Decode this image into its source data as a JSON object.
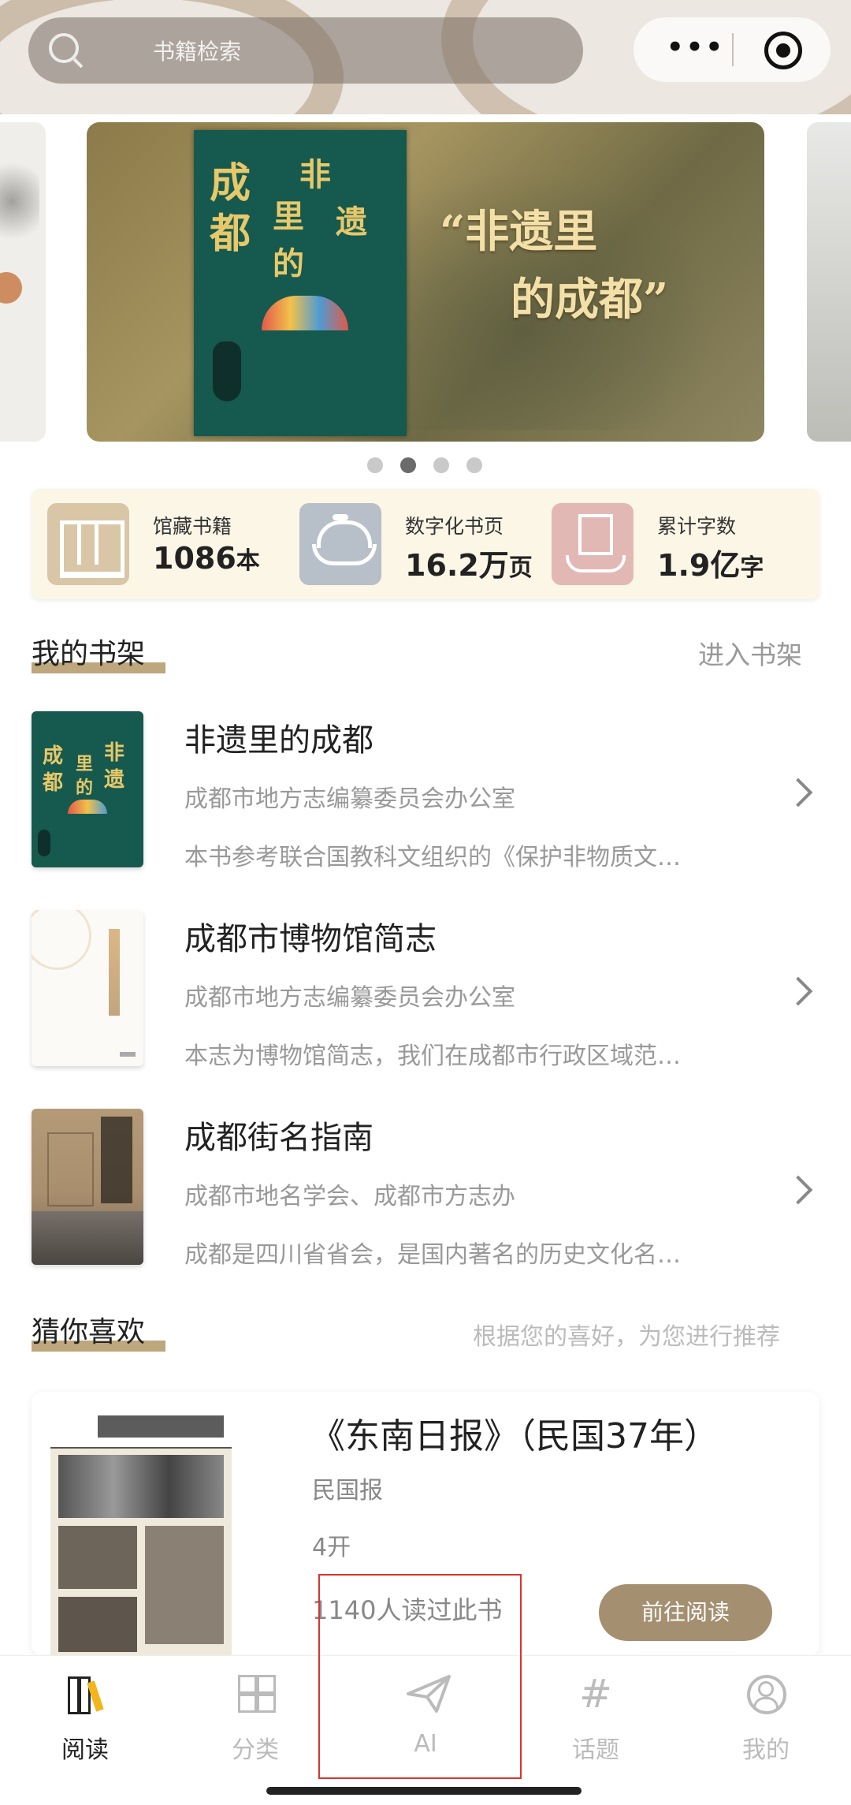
{
  "header": {
    "search_placeholder": "书籍检索",
    "menu_icon": "more-dots-icon",
    "record_icon": "record-icon"
  },
  "carousel": {
    "banner": {
      "cover_title": "成都 非遗 里 的",
      "overlay_text_line1": "“非遗里",
      "overlay_text_line2": "的成都”"
    },
    "dots_count": 4,
    "active_dot": 1
  },
  "stats": [
    {
      "label": "馆藏书籍",
      "value": "1086",
      "unit": "本",
      "icon": "bookshelf-icon"
    },
    {
      "label": "数字化书页",
      "value": "16.2万",
      "unit": "页",
      "icon": "tea-bowl-icon"
    },
    {
      "label": "累计字数",
      "value": "1.9亿",
      "unit": "字",
      "icon": "hand-book-icon"
    }
  ],
  "my_shelf": {
    "title": "我的书架",
    "link": "进入书架",
    "books": [
      {
        "title": "非遗里的成都",
        "author": "成都市地方志编纂委员会办公室",
        "desc": "本书参考联合国教科文组织的《保护非物质文…"
      },
      {
        "title": "成都市博物馆简志",
        "author": "成都市地方志编纂委员会办公室",
        "desc": "本志为博物馆简志，我们在成都市行政区域范…"
      },
      {
        "title": "成都街名指南",
        "author": "成都市地名学会、成都市方志办",
        "desc": "成都是四川省省会，是国内著名的历史文化名…"
      }
    ]
  },
  "recommend": {
    "title": "猜你喜欢",
    "hint": "根据您的喜好，为您进行推荐",
    "card": {
      "title": "《东南日报》（民国37年）",
      "category": "民国报",
      "size": "4开",
      "reads": "1140人读过此书",
      "button": "前往阅读"
    }
  },
  "tabbar": {
    "tabs": [
      {
        "label": "阅读",
        "icon": "books-icon",
        "active": true
      },
      {
        "label": "分类",
        "icon": "grid-icon",
        "active": false
      },
      {
        "label": "AI",
        "icon": "paper-plane-icon",
        "active": false
      },
      {
        "label": "话题",
        "icon": "hash-icon",
        "active": false
      },
      {
        "label": "我的",
        "icon": "user-icon",
        "active": false
      }
    ]
  },
  "colors": {
    "accent_gold": "#b79c6f",
    "button_brown": "#a48f70",
    "highlight_red": "#d9342b"
  }
}
